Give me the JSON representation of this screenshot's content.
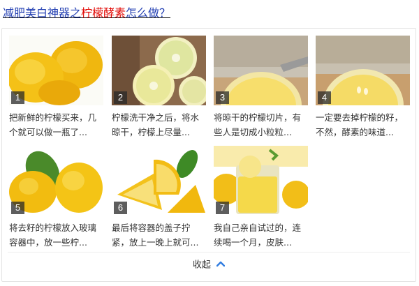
{
  "header": {
    "title_part1": "减肥美白神器之",
    "title_part2": "柠檬酵素",
    "title_part3": "怎么做？"
  },
  "colors": {
    "link_blue": "#2440b3",
    "highlight_red": "#e10602",
    "chevron_blue": "#2f7ce0"
  },
  "steps": [
    {
      "num": "1",
      "caption": "把新鲜的柠檬买来，几个就可以做一瓶了...",
      "image": "whole-lemons"
    },
    {
      "num": "2",
      "caption": "柠檬洗干净之后，将水晾干，柠檬上尽量...",
      "image": "lemon-slices-board"
    },
    {
      "num": "3",
      "caption": "将晾干的柠檬切片，有些人是切成小粒粒...",
      "image": "lemon-slice-knife"
    },
    {
      "num": "4",
      "caption": "一定要去掉柠檬的籽，不然，酵素的味道...",
      "image": "lemon-slice-seeds"
    },
    {
      "num": "5",
      "caption": "将去籽的柠檬放入玻璃容器中，放一些柠...",
      "image": "lemons-with-leaves"
    },
    {
      "num": "6",
      "caption": "最后将容器的盖子拧紧，放上一晚上就可...",
      "image": "lemon-wedges"
    },
    {
      "num": "7",
      "caption": "我自己亲自试过的，连续喝一个月，皮肤...",
      "image": "lemon-drink-glass"
    }
  ],
  "footer": {
    "collapse_label": "收起",
    "collapse_icon": "chevron-up-icon"
  }
}
